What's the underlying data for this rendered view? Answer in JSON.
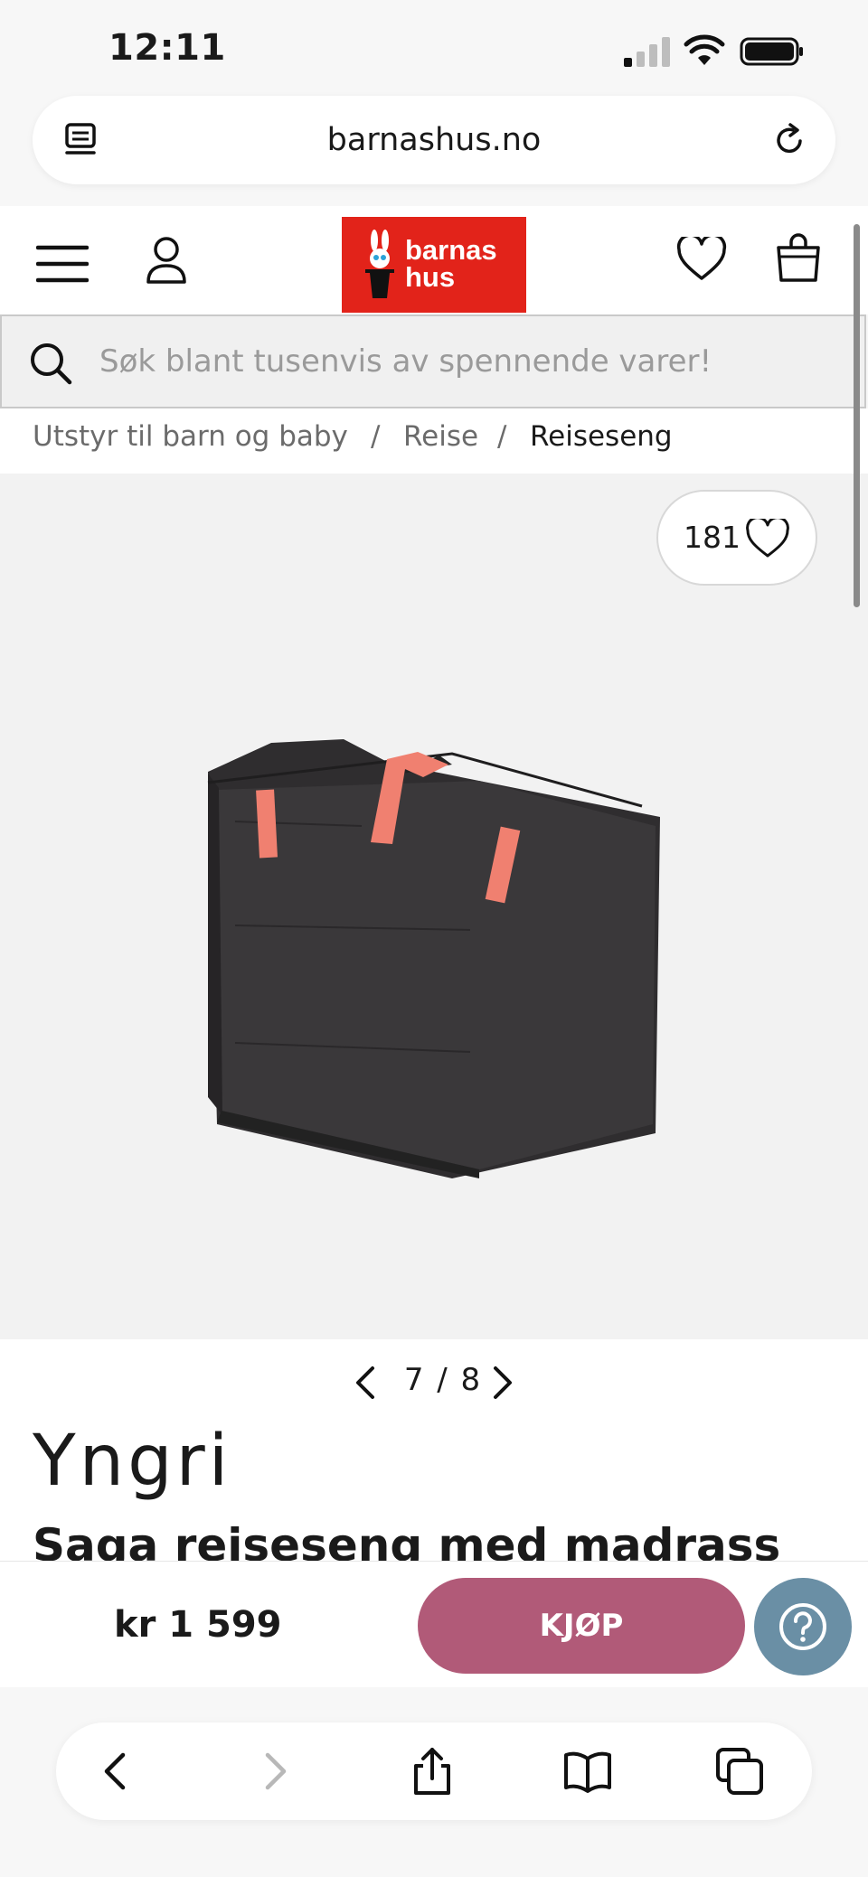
{
  "status_bar": {
    "time": "12:11",
    "icons": [
      "signal-icon",
      "wifi-icon",
      "battery-icon"
    ]
  },
  "browser": {
    "url": "barnashus.no",
    "icons": [
      "reader-icon",
      "reload-icon"
    ]
  },
  "header": {
    "logo_text_line1": "barnas",
    "logo_text_line2": "hus",
    "icons": [
      "menu-icon",
      "user-icon",
      "heart-icon",
      "bag-icon"
    ],
    "logo_color": "#e2231a"
  },
  "search": {
    "placeholder": "Søk blant tusenvis av spennende varer!"
  },
  "breadcrumb": {
    "items": [
      "Utstyr til barn og baby",
      "Reise",
      "Reiseseng"
    ],
    "separator": "/"
  },
  "gallery": {
    "likes": "181",
    "current": "7",
    "separator": "/",
    "total": "8"
  },
  "product": {
    "brand": "Yngri",
    "title": "Saga reiseseng med madrass",
    "price": "kr 1 599",
    "buy_label": "KJØP"
  },
  "colors": {
    "buy_button": "#b15a78",
    "help_button": "#6a8fa5",
    "strap": "#f08070"
  },
  "toolbar": {
    "icons": [
      "back-icon",
      "forward-icon",
      "share-icon",
      "bookmarks-icon",
      "tabs-icon"
    ]
  }
}
